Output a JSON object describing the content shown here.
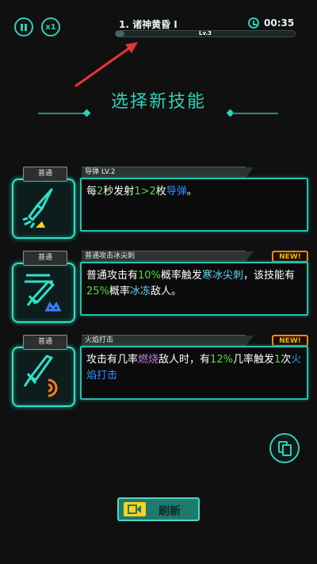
{
  "hud": {
    "speed_label": "x1",
    "stage_title": "1. 诸神黄昏 I",
    "timer": "00:35",
    "level_label": "Lv.3",
    "level_progress": 0.05
  },
  "heading": "选择新技能",
  "skills": [
    {
      "type": "普通",
      "name": "导弹 LV.2",
      "icon": "missile-icon",
      "badge": "",
      "desc": [
        {
          "t": "每",
          "c": ""
        },
        {
          "t": "2",
          "c": "g"
        },
        {
          "t": "秒发射",
          "c": ""
        },
        {
          "t": "1>2",
          "c": "g"
        },
        {
          "t": "枚",
          "c": ""
        },
        {
          "t": "导弹",
          "c": "b"
        },
        {
          "t": "。",
          "c": ""
        }
      ]
    },
    {
      "type": "普通",
      "name": "普通攻击冰尖刺",
      "icon": "ice-sword-icon",
      "badge": "NEW!",
      "desc": [
        {
          "t": "普通攻击有",
          "c": ""
        },
        {
          "t": "10%",
          "c": "g"
        },
        {
          "t": "概率触发",
          "c": ""
        },
        {
          "t": "寒冰尖刺",
          "c": "c"
        },
        {
          "t": "，该技能有",
          "c": ""
        },
        {
          "t": "25%",
          "c": "g"
        },
        {
          "t": "概率",
          "c": ""
        },
        {
          "t": "冰冻",
          "c": "c"
        },
        {
          "t": "敌人。",
          "c": ""
        }
      ]
    },
    {
      "type": "普通",
      "name": "火焰打击",
      "icon": "fire-sword-icon",
      "badge": "NEW!",
      "desc": [
        {
          "t": "攻击有几率",
          "c": ""
        },
        {
          "t": "燃烧",
          "c": "p"
        },
        {
          "t": "敌人时，有",
          "c": ""
        },
        {
          "t": "12%",
          "c": "g"
        },
        {
          "t": "几率触发",
          "c": ""
        },
        {
          "t": "1",
          "c": "g"
        },
        {
          "t": "次",
          "c": ""
        },
        {
          "t": "火焰打击",
          "c": "b"
        }
      ]
    }
  ],
  "refresh_label": "刷新",
  "colors": {
    "accent": "#2fd0b8",
    "highlight_green": "#51d93c",
    "highlight_blue": "#2e8fff",
    "new_badge": "#ff8c00"
  }
}
